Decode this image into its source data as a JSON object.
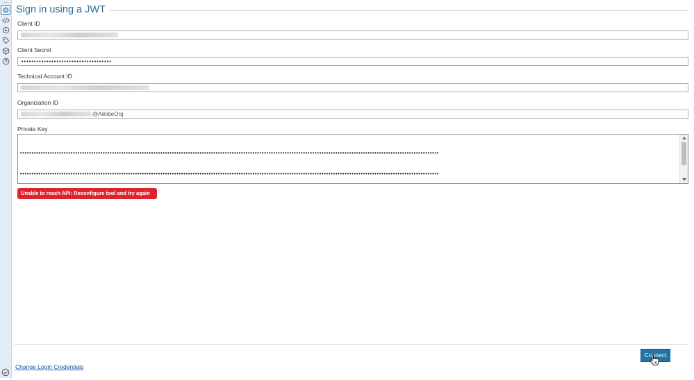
{
  "header": {
    "title": "Sign in using a JWT"
  },
  "rail": {
    "icons": [
      "settings-icon",
      "code-icon",
      "connection-icon",
      "tag-icon",
      "cube-icon",
      "help-icon"
    ],
    "bottom_icon": "check-circle-icon"
  },
  "form": {
    "client_id": {
      "label": "Client ID",
      "value": ""
    },
    "client_secret": {
      "label": "Client Secret",
      "value": "••••••••••••••••••••••••••••••••••••"
    },
    "technical_account_id": {
      "label": "Technical Account ID",
      "value": ""
    },
    "organization_id": {
      "label": "Organization ID",
      "suffix": "@AdobeOrg"
    },
    "private_key": {
      "label": "Private Key",
      "lines": [
        "••••••••••••••••••••••••••••••••••••••••••••••••••••••••••••••••••••••••••••••••••••••••••••••••••••••••••••••••••••••••••••••••••••••••••••••••••••••••••••••••••••••••••••••••••••••",
        "••••••••••••••••••••••••••••••••••••••••••••••••••••••••••••••••••••••••••••••••••••••••••••••••••••••••••••••••••••••••••••••••••••••••••••••••••••••••••••••••••••••••••••••••••••••",
        "••••••••••••••••••••••••••••••••••••••••••••••••••••••••••••••••••••••••••••••••••••••••••••••••••••••••••••••••••••••••••••••••••••••••••••••••••••••••••••••••••••••••••••••••••••••",
        "••••••••••••••••••••••••••••••••••••••••••••••••••••••••••••••••••••••••••••••••••••••••••••••••••••••••••••••••••••••••••••••••••••••••••••••••••••••••••••••••••••••••••••••••••••••",
        "••••••••••••••••••••••••••••••••••••••••••••••••••••••••••••••••••••••••••••••••••••••••••••••••••••••••••••••••••••••••••••••••••••••••••••••••••••••••••••••••••••••••••••••••••••••",
        "••••••••••••••••••••••••••••••••••••••••••••••••••••••••••••••••••••••••••••••••••••••••••••••••••••••••••••••••••••••••••••••••••••••••••••••••••••••••••••••••••••••••••••••••••••••",
        "••••••••••••••••••••••••••••••••••••••••••••••••••••••••••••••••••••••••••••••••••••••••••••••••••••••••••••••••••••••••••••••••••••••••••••••••••••••••••••••••••••••••••••••••••••••"
      ]
    }
  },
  "error": {
    "text": "Unable to reach API: Reconfigure tool and try again",
    "color": "#e0242f"
  },
  "footer": {
    "change_login_label": "Change Login Credentials",
    "connect_label": "Connect"
  },
  "colors": {
    "accent": "#2a6f9c",
    "button": "#1f75a8"
  }
}
